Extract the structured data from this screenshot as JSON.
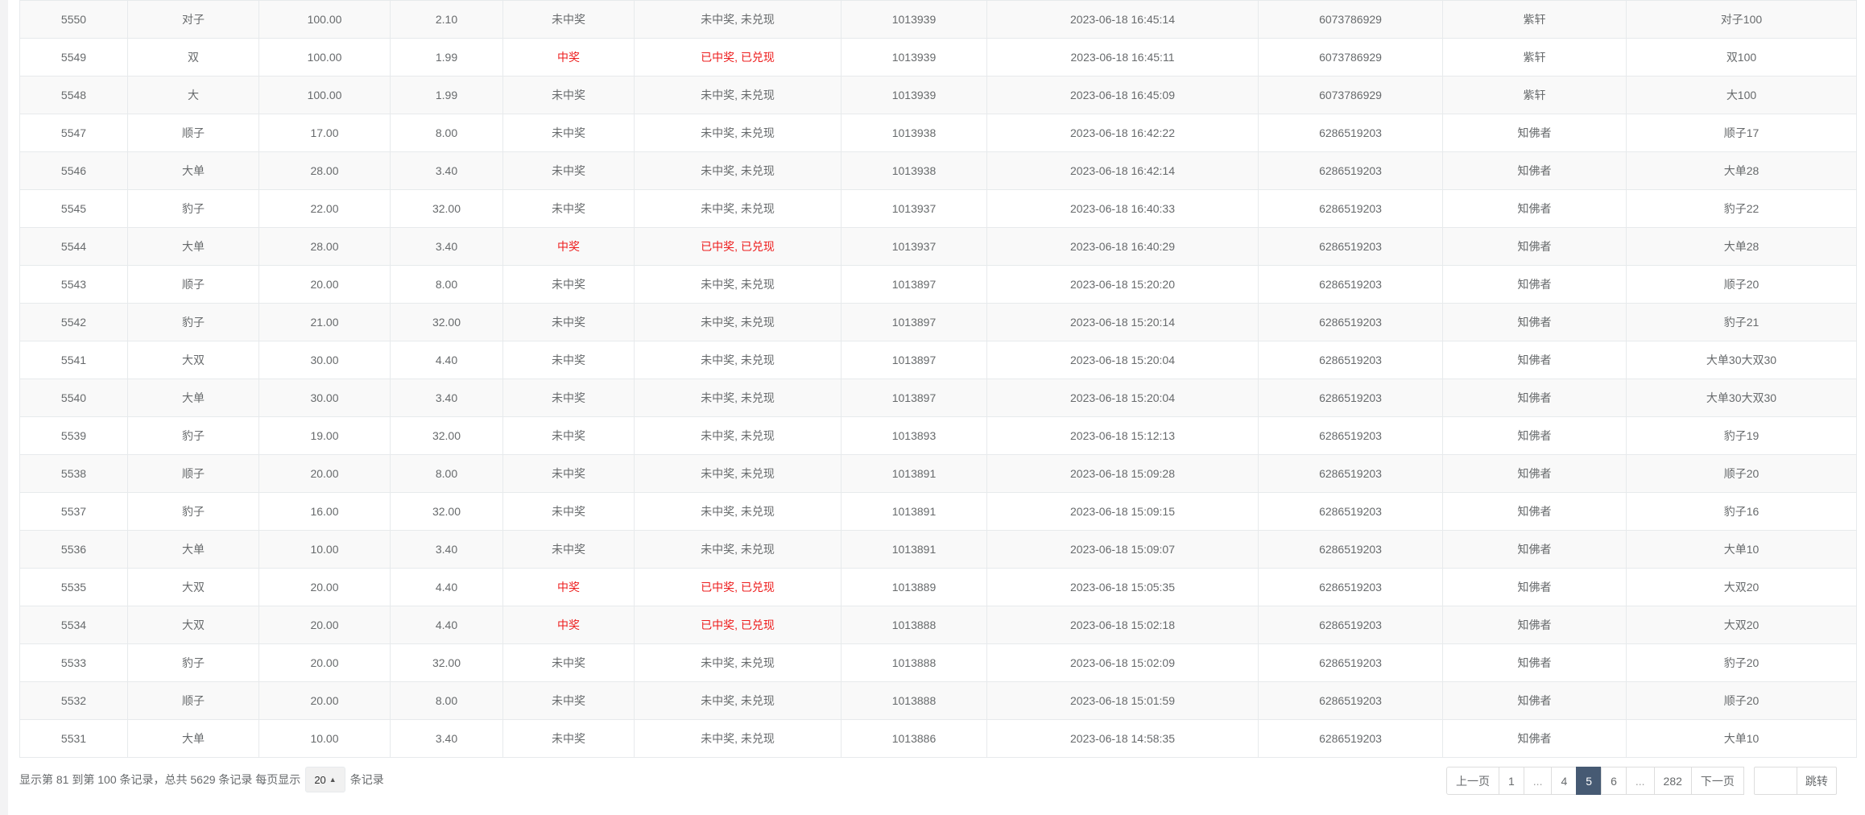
{
  "table": {
    "rows": [
      {
        "id": "5550",
        "type": "对子",
        "amount": "100.00",
        "odds": "2.10",
        "result": "未中奖",
        "status": "未中奖, 未兑现",
        "period": "1013939",
        "time": "2023-06-18 16:45:14",
        "user_id": "6073786929",
        "username": "紫轩",
        "content": "对子100",
        "win": false
      },
      {
        "id": "5549",
        "type": "双",
        "amount": "100.00",
        "odds": "1.99",
        "result": "中奖",
        "status": "已中奖, 已兑现",
        "period": "1013939",
        "time": "2023-06-18 16:45:11",
        "user_id": "6073786929",
        "username": "紫轩",
        "content": "双100",
        "win": true
      },
      {
        "id": "5548",
        "type": "大",
        "amount": "100.00",
        "odds": "1.99",
        "result": "未中奖",
        "status": "未中奖, 未兑现",
        "period": "1013939",
        "time": "2023-06-18 16:45:09",
        "user_id": "6073786929",
        "username": "紫轩",
        "content": "大100",
        "win": false
      },
      {
        "id": "5547",
        "type": "顺子",
        "amount": "17.00",
        "odds": "8.00",
        "result": "未中奖",
        "status": "未中奖, 未兑现",
        "period": "1013938",
        "time": "2023-06-18 16:42:22",
        "user_id": "6286519203",
        "username": "知佛者",
        "content": "顺子17",
        "win": false
      },
      {
        "id": "5546",
        "type": "大单",
        "amount": "28.00",
        "odds": "3.40",
        "result": "未中奖",
        "status": "未中奖, 未兑现",
        "period": "1013938",
        "time": "2023-06-18 16:42:14",
        "user_id": "6286519203",
        "username": "知佛者",
        "content": "大单28",
        "win": false
      },
      {
        "id": "5545",
        "type": "豹子",
        "amount": "22.00",
        "odds": "32.00",
        "result": "未中奖",
        "status": "未中奖, 未兑现",
        "period": "1013937",
        "time": "2023-06-18 16:40:33",
        "user_id": "6286519203",
        "username": "知佛者",
        "content": "豹子22",
        "win": false
      },
      {
        "id": "5544",
        "type": "大单",
        "amount": "28.00",
        "odds": "3.40",
        "result": "中奖",
        "status": "已中奖, 已兑现",
        "period": "1013937",
        "time": "2023-06-18 16:40:29",
        "user_id": "6286519203",
        "username": "知佛者",
        "content": "大单28",
        "win": true
      },
      {
        "id": "5543",
        "type": "顺子",
        "amount": "20.00",
        "odds": "8.00",
        "result": "未中奖",
        "status": "未中奖, 未兑现",
        "period": "1013897",
        "time": "2023-06-18 15:20:20",
        "user_id": "6286519203",
        "username": "知佛者",
        "content": "顺子20",
        "win": false
      },
      {
        "id": "5542",
        "type": "豹子",
        "amount": "21.00",
        "odds": "32.00",
        "result": "未中奖",
        "status": "未中奖, 未兑现",
        "period": "1013897",
        "time": "2023-06-18 15:20:14",
        "user_id": "6286519203",
        "username": "知佛者",
        "content": "豹子21",
        "win": false
      },
      {
        "id": "5541",
        "type": "大双",
        "amount": "30.00",
        "odds": "4.40",
        "result": "未中奖",
        "status": "未中奖, 未兑现",
        "period": "1013897",
        "time": "2023-06-18 15:20:04",
        "user_id": "6286519203",
        "username": "知佛者",
        "content": "大单30大双30",
        "win": false
      },
      {
        "id": "5540",
        "type": "大单",
        "amount": "30.00",
        "odds": "3.40",
        "result": "未中奖",
        "status": "未中奖, 未兑现",
        "period": "1013897",
        "time": "2023-06-18 15:20:04",
        "user_id": "6286519203",
        "username": "知佛者",
        "content": "大单30大双30",
        "win": false
      },
      {
        "id": "5539",
        "type": "豹子",
        "amount": "19.00",
        "odds": "32.00",
        "result": "未中奖",
        "status": "未中奖, 未兑现",
        "period": "1013893",
        "time": "2023-06-18 15:12:13",
        "user_id": "6286519203",
        "username": "知佛者",
        "content": "豹子19",
        "win": false
      },
      {
        "id": "5538",
        "type": "顺子",
        "amount": "20.00",
        "odds": "8.00",
        "result": "未中奖",
        "status": "未中奖, 未兑现",
        "period": "1013891",
        "time": "2023-06-18 15:09:28",
        "user_id": "6286519203",
        "username": "知佛者",
        "content": "顺子20",
        "win": false
      },
      {
        "id": "5537",
        "type": "豹子",
        "amount": "16.00",
        "odds": "32.00",
        "result": "未中奖",
        "status": "未中奖, 未兑现",
        "period": "1013891",
        "time": "2023-06-18 15:09:15",
        "user_id": "6286519203",
        "username": "知佛者",
        "content": "豹子16",
        "win": false
      },
      {
        "id": "5536",
        "type": "大单",
        "amount": "10.00",
        "odds": "3.40",
        "result": "未中奖",
        "status": "未中奖, 未兑现",
        "period": "1013891",
        "time": "2023-06-18 15:09:07",
        "user_id": "6286519203",
        "username": "知佛者",
        "content": "大单10",
        "win": false
      },
      {
        "id": "5535",
        "type": "大双",
        "amount": "20.00",
        "odds": "4.40",
        "result": "中奖",
        "status": "已中奖, 已兑现",
        "period": "1013889",
        "time": "2023-06-18 15:05:35",
        "user_id": "6286519203",
        "username": "知佛者",
        "content": "大双20",
        "win": true
      },
      {
        "id": "5534",
        "type": "大双",
        "amount": "20.00",
        "odds": "4.40",
        "result": "中奖",
        "status": "已中奖, 已兑现",
        "period": "1013888",
        "time": "2023-06-18 15:02:18",
        "user_id": "6286519203",
        "username": "知佛者",
        "content": "大双20",
        "win": true
      },
      {
        "id": "5533",
        "type": "豹子",
        "amount": "20.00",
        "odds": "32.00",
        "result": "未中奖",
        "status": "未中奖, 未兑现",
        "period": "1013888",
        "time": "2023-06-18 15:02:09",
        "user_id": "6286519203",
        "username": "知佛者",
        "content": "豹子20",
        "win": false
      },
      {
        "id": "5532",
        "type": "顺子",
        "amount": "20.00",
        "odds": "8.00",
        "result": "未中奖",
        "status": "未中奖, 未兑现",
        "period": "1013888",
        "time": "2023-06-18 15:01:59",
        "user_id": "6286519203",
        "username": "知佛者",
        "content": "顺子20",
        "win": false
      },
      {
        "id": "5531",
        "type": "大单",
        "amount": "10.00",
        "odds": "3.40",
        "result": "未中奖",
        "status": "未中奖, 未兑现",
        "period": "1013886",
        "time": "2023-06-18 14:58:35",
        "user_id": "6286519203",
        "username": "知佛者",
        "content": "大单10",
        "win": false
      }
    ]
  },
  "footer": {
    "summary": "显示第 81 到第 100 条记录，总共 5629 条记录 每页显示",
    "page_size": "20",
    "suffix": "条记录"
  },
  "pagination": {
    "pages": [
      {
        "label": "上一页",
        "kind": "prev"
      },
      {
        "label": "1",
        "kind": "page"
      },
      {
        "label": "...",
        "kind": "ellipsis"
      },
      {
        "label": "4",
        "kind": "page"
      },
      {
        "label": "5",
        "kind": "active"
      },
      {
        "label": "6",
        "kind": "page"
      },
      {
        "label": "...",
        "kind": "ellipsis"
      },
      {
        "label": "282",
        "kind": "page"
      },
      {
        "label": "下一页",
        "kind": "next"
      }
    ],
    "jump_value": "",
    "jump_label": "跳转"
  },
  "colors": {
    "win_text": "#ed1c1c",
    "active_page_bg": "#465a73"
  }
}
